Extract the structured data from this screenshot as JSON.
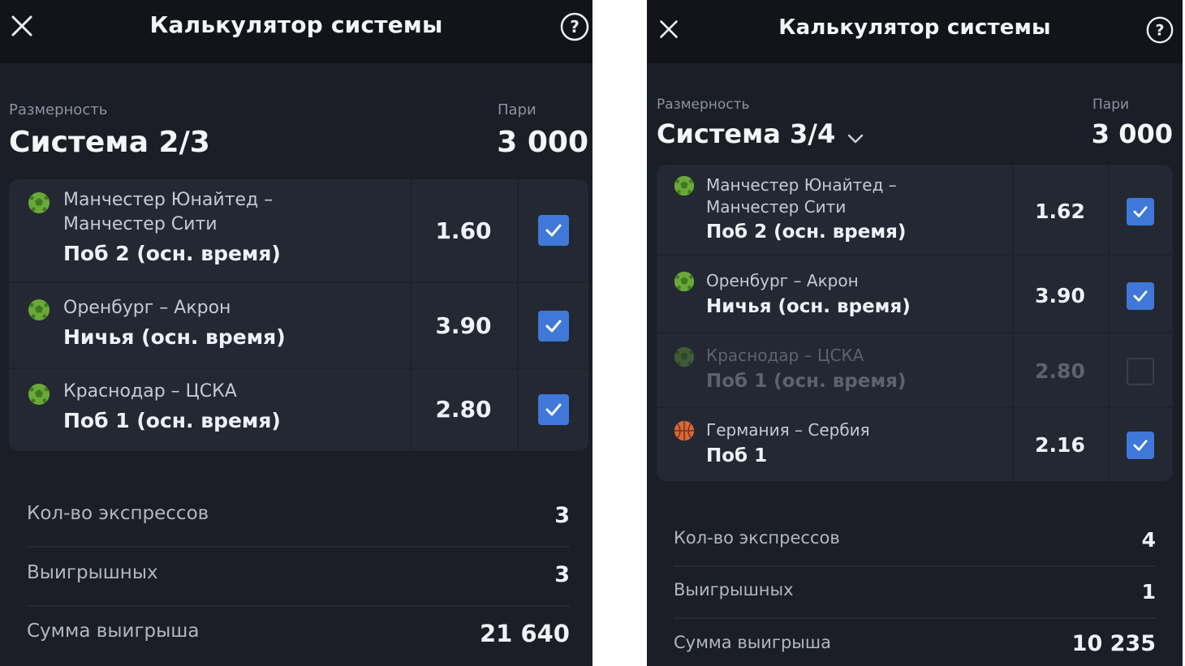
{
  "colors": {
    "panel_bg": "#1b1e26",
    "header_bg": "#121419",
    "card_bg": "#242833",
    "checkbox_accent": "#3f78d8",
    "football_green": "#6aa83a",
    "basketball_orange": "#d4693a"
  },
  "left": {
    "header": {
      "title": "Калькулятор системы",
      "close_icon": "close-icon",
      "help_icon": "help-icon"
    },
    "system": {
      "label": "Размерность",
      "value": "Система 2/3"
    },
    "stake": {
      "label": "Пари",
      "value": "3 000"
    },
    "bets": [
      {
        "sport_icon": "football-icon",
        "match_line1": "Манчестер Юнайтед –",
        "match_line2": "Манчестер Сити",
        "market": "Поб 2 (осн. время)",
        "coef": "1.60",
        "checked": true
      },
      {
        "sport_icon": "football-icon",
        "match_line1": "Оренбург – Акрон",
        "match_line2": "",
        "market": "Ничья (осн. время)",
        "coef": "3.90",
        "checked": true
      },
      {
        "sport_icon": "football-icon",
        "match_line1": "Краснодар – ЦСКА",
        "match_line2": "",
        "market": "Поб 1 (осн. время)",
        "coef": "2.80",
        "checked": true
      }
    ],
    "stats": [
      {
        "label": "Кол-во экспрессов",
        "value": "3"
      },
      {
        "label": "Выигрышных",
        "value": "3"
      },
      {
        "label": "Сумма выигрыша",
        "value": "21 640"
      }
    ]
  },
  "right": {
    "header": {
      "title": "Калькулятор системы",
      "close_icon": "close-icon",
      "help_icon": "help-icon"
    },
    "system": {
      "label": "Размерность",
      "value": "Система 3/4",
      "dropdown_icon": "chevron-down-icon"
    },
    "stake": {
      "label": "Пари",
      "value": "3 000"
    },
    "bets": [
      {
        "sport_icon": "football-icon",
        "match_line1": "Манчестер Юнайтед –",
        "match_line2": "Манчестер Сити",
        "market": "Поб 2 (осн. время)",
        "coef": "1.62",
        "checked": true
      },
      {
        "sport_icon": "football-icon",
        "match_line1": "Оренбург – Акрон",
        "match_line2": "",
        "market": "Ничья (осн. время)",
        "coef": "3.90",
        "checked": true
      },
      {
        "sport_icon": "football-icon",
        "match_line1": "Краснодар – ЦСКА",
        "match_line2": "",
        "market": "Поб 1 (осн. время)",
        "coef": "2.80",
        "checked": false
      },
      {
        "sport_icon": "basketball-icon",
        "match_line1": "Германия – Сербия",
        "match_line2": "",
        "market": "Поб 1",
        "coef": "2.16",
        "checked": true
      }
    ],
    "stats": [
      {
        "label": "Кол-во экспрессов",
        "value": "4"
      },
      {
        "label": "Выигрышных",
        "value": "1"
      },
      {
        "label": "Сумма выигрыша",
        "value": "10 235"
      }
    ]
  }
}
